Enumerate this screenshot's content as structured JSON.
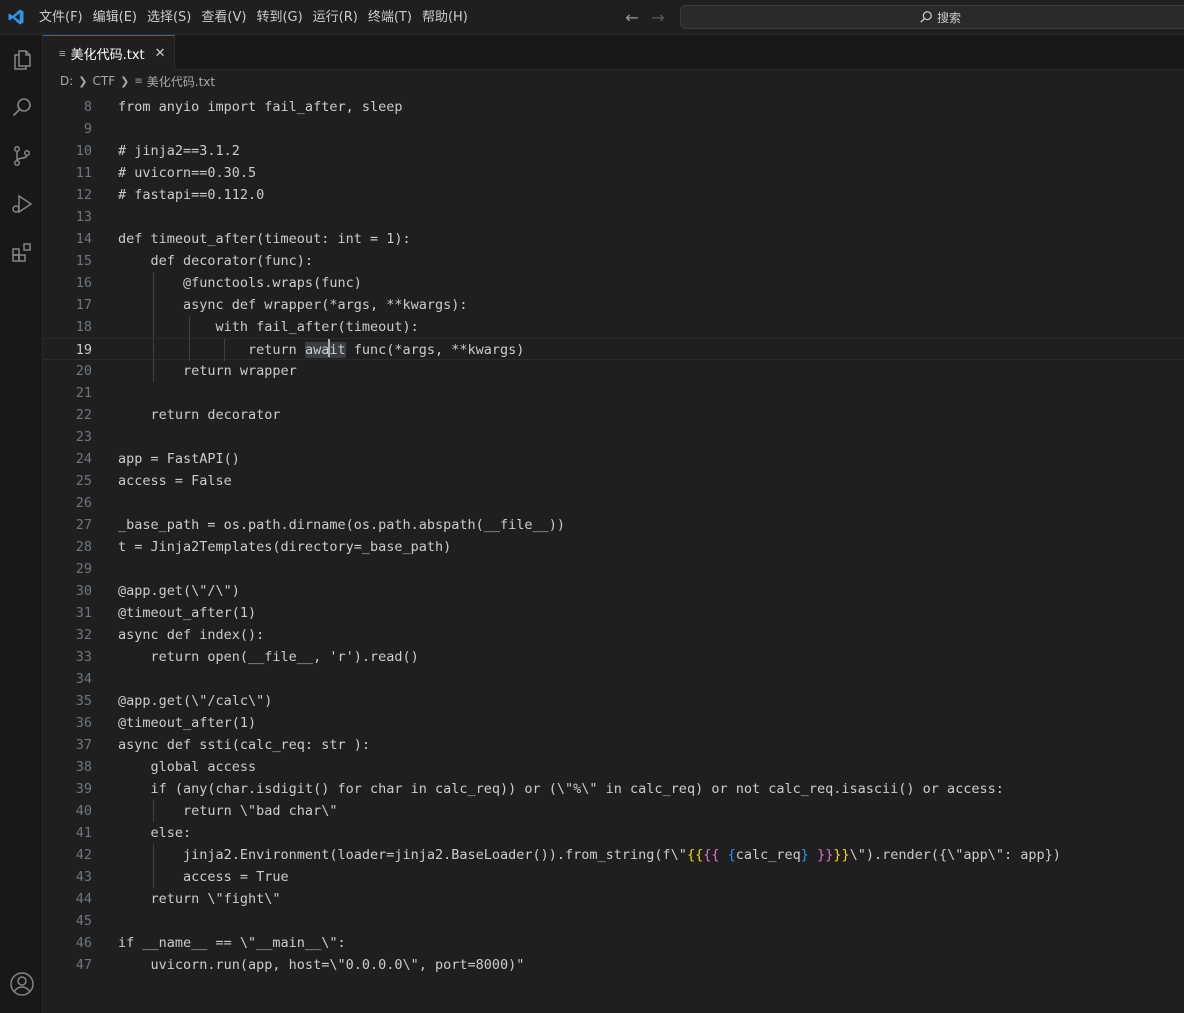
{
  "menu": [
    "文件(F)",
    "编辑(E)",
    "选择(S)",
    "查看(V)",
    "转到(G)",
    "运行(R)",
    "终端(T)",
    "帮助(H)"
  ],
  "search": {
    "label": "搜索"
  },
  "tab": {
    "label": "美化代码.txt",
    "close": "✕"
  },
  "breadcrumb": {
    "drive": "D:",
    "folder": "CTF",
    "file": "美化代码.txt"
  },
  "editor": {
    "current_line": "19",
    "lines": [
      {
        "n": "8",
        "text": "from anyio import fail_after, sleep"
      },
      {
        "n": "9",
        "text": ""
      },
      {
        "n": "10",
        "text": "# jinja2==3.1.2"
      },
      {
        "n": "11",
        "text": "# uvicorn==0.30.5"
      },
      {
        "n": "12",
        "text": "# fastapi==0.112.0"
      },
      {
        "n": "13",
        "text": ""
      },
      {
        "n": "14",
        "text": "def timeout_after(timeout: int = 1):"
      },
      {
        "n": "15",
        "text": "    def decorator(func):"
      },
      {
        "n": "16",
        "text": "        @functools.wraps(func)"
      },
      {
        "n": "17",
        "text": "        async def wrapper(*args, **kwargs):"
      },
      {
        "n": "18",
        "text": "            with fail_after(timeout):"
      },
      {
        "n": "19",
        "text": "                return await func(*args, **kwargs)"
      },
      {
        "n": "20",
        "text": "        return wrapper"
      },
      {
        "n": "21",
        "text": ""
      },
      {
        "n": "22",
        "text": "    return decorator"
      },
      {
        "n": "23",
        "text": ""
      },
      {
        "n": "24",
        "text": "app = FastAPI()"
      },
      {
        "n": "25",
        "text": "access = False"
      },
      {
        "n": "26",
        "text": ""
      },
      {
        "n": "27",
        "text": "_base_path = os.path.dirname(os.path.abspath(__file__))"
      },
      {
        "n": "28",
        "text": "t = Jinja2Templates(directory=_base_path)"
      },
      {
        "n": "29",
        "text": ""
      },
      {
        "n": "30",
        "text": "@app.get(\\\"/\\\")"
      },
      {
        "n": "31",
        "text": "@timeout_after(1)"
      },
      {
        "n": "32",
        "text": "async def index():"
      },
      {
        "n": "33",
        "text": "    return open(__file__, 'r').read()"
      },
      {
        "n": "34",
        "text": ""
      },
      {
        "n": "35",
        "text": "@app.get(\\\"/calc\\\")"
      },
      {
        "n": "36",
        "text": "@timeout_after(1)"
      },
      {
        "n": "37",
        "text": "async def ssti(calc_req: str ):"
      },
      {
        "n": "38",
        "text": "    global access"
      },
      {
        "n": "39",
        "text": "    if (any(char.isdigit() for char in calc_req)) or (\\\"%\\\" in calc_req) or not calc_req.isascii() or access:"
      },
      {
        "n": "40",
        "text": "        return \\\"bad char\\\""
      },
      {
        "n": "41",
        "text": "    else:"
      },
      {
        "n": "42",
        "text": "        jinja2.Environment(loader=jinja2.BaseLoader()).from_string(f\\\"{{{{ {calc_req} }}}}\\\").render({\\\"app\\\": app})"
      },
      {
        "n": "43",
        "text": "        access = True"
      },
      {
        "n": "44",
        "text": "    return \\\"fight\\\""
      },
      {
        "n": "45",
        "text": ""
      },
      {
        "n": "46",
        "text": "if __name__ == \\\"__main__\\\":"
      },
      {
        "n": "47",
        "text": "    uvicorn.run(app, host=\\\"0.0.0.0\\\", port=8000)\""
      }
    ]
  },
  "colors": {
    "accent": "#0078d4",
    "background": "#1f1f1f",
    "sidebar": "#181818"
  },
  "icons": [
    "vscode-logo-icon",
    "explorer-icon",
    "search-icon",
    "source-control-icon",
    "run-debug-icon",
    "extensions-icon",
    "account-icon"
  ]
}
